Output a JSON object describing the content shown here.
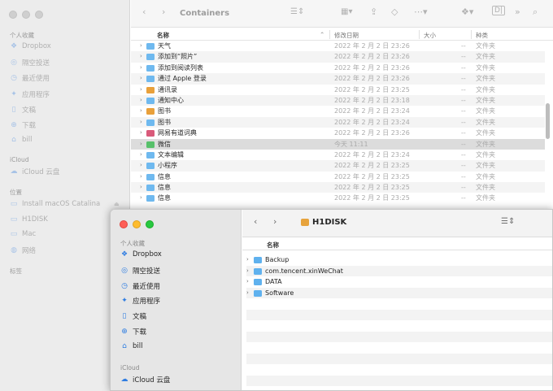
{
  "back": {
    "title": "Containers",
    "sidebar": {
      "favorites_label": "个人收藏",
      "favorites": [
        {
          "label": "Dropbox",
          "icon": "dropbox-icon"
        },
        {
          "label": "隔空投送",
          "icon": "airdrop-icon"
        },
        {
          "label": "最近使用",
          "icon": "clock-icon"
        },
        {
          "label": "应用程序",
          "icon": "applications-icon"
        },
        {
          "label": "文稿",
          "icon": "document-icon"
        },
        {
          "label": "下载",
          "icon": "download-icon"
        },
        {
          "label": "bill",
          "icon": "home-icon"
        }
      ],
      "icloud_label": "iCloud",
      "icloud": [
        {
          "label": "iCloud 云盘",
          "icon": "cloud-icon"
        }
      ],
      "locations_label": "位置",
      "locations": [
        {
          "label": "Install macOS Catalina",
          "icon": "disk-icon",
          "eject": true
        },
        {
          "label": "H1DISK",
          "icon": "disk-icon",
          "eject": false
        },
        {
          "label": "Mac",
          "icon": "computer-icon",
          "eject": false
        },
        {
          "label": "网络",
          "icon": "network-icon",
          "eject": false
        }
      ],
      "tags_label": "标签"
    },
    "columns": {
      "name": "名称",
      "date": "修改日期",
      "size": "大小",
      "kind": "种类"
    },
    "rows": [
      {
        "name": "天气",
        "date": "2022 年 2 月 2 日 23:26",
        "size": "--",
        "kind": "文件夹",
        "icon": "folder"
      },
      {
        "name": "添加到“照片”",
        "date": "2022 年 2 月 2 日 23:26",
        "size": "--",
        "kind": "文件夹",
        "icon": "folder"
      },
      {
        "name": "添加到阅读列表",
        "date": "2022 年 2 月 2 日 23:26",
        "size": "--",
        "kind": "文件夹",
        "icon": "folder"
      },
      {
        "name": "通过 Apple 登录",
        "date": "2022 年 2 月 2 日 23:26",
        "size": "--",
        "kind": "文件夹",
        "icon": "folder"
      },
      {
        "name": "通讯录",
        "date": "2022 年 2 月 2 日 23:25",
        "size": "--",
        "kind": "文件夹",
        "icon": "app"
      },
      {
        "name": "通知中心",
        "date": "2022 年 2 月 2 日 23:18",
        "size": "--",
        "kind": "文件夹",
        "icon": "folder"
      },
      {
        "name": "图书",
        "date": "2022 年 2 月 2 日 23:24",
        "size": "--",
        "kind": "文件夹",
        "icon": "app"
      },
      {
        "name": "图书",
        "date": "2022 年 2 月 2 日 23:24",
        "size": "--",
        "kind": "文件夹",
        "icon": "folder"
      },
      {
        "name": "网易有道词典",
        "date": "2022 年 2 月 2 日 23:26",
        "size": "--",
        "kind": "文件夹",
        "icon": "pink"
      },
      {
        "name": "微信",
        "date": "今天 11:11",
        "size": "--",
        "kind": "文件夹",
        "icon": "green",
        "selected": true
      },
      {
        "name": "文本编辑",
        "date": "2022 年 2 月 2 日 23:24",
        "size": "--",
        "kind": "文件夹",
        "icon": "folder"
      },
      {
        "name": "小程序",
        "date": "2022 年 2 月 2 日 23:25",
        "size": "--",
        "kind": "文件夹",
        "icon": "folder"
      },
      {
        "name": "信息",
        "date": "2022 年 2 月 2 日 23:25",
        "size": "--",
        "kind": "文件夹",
        "icon": "folder"
      },
      {
        "name": "信息",
        "date": "2022 年 2 月 2 日 23:25",
        "size": "--",
        "kind": "文件夹",
        "icon": "folder"
      },
      {
        "name": "信息",
        "date": "2022 年 2 月 2 日 23:25",
        "size": "--",
        "kind": "文件夹",
        "icon": "folder"
      }
    ]
  },
  "front": {
    "title": "H1DISK",
    "sidebar": {
      "favorites_label": "个人收藏",
      "favorites": [
        {
          "label": "Dropbox",
          "icon": "dropbox-icon"
        },
        {
          "label": "隔空投送",
          "icon": "airdrop-icon"
        },
        {
          "label": "最近使用",
          "icon": "clock-icon"
        },
        {
          "label": "应用程序",
          "icon": "applications-icon"
        },
        {
          "label": "文稿",
          "icon": "document-icon"
        },
        {
          "label": "下载",
          "icon": "download-icon"
        },
        {
          "label": "bill",
          "icon": "home-icon"
        }
      ],
      "icloud_label": "iCloud",
      "icloud": [
        {
          "label": "iCloud 云盘",
          "icon": "cloud-icon"
        }
      ]
    },
    "columns": {
      "name": "名称"
    },
    "rows": [
      {
        "name": "Backup"
      },
      {
        "name": "com.tencent.xinWeChat"
      },
      {
        "name": "DATA"
      },
      {
        "name": "Software"
      }
    ]
  }
}
